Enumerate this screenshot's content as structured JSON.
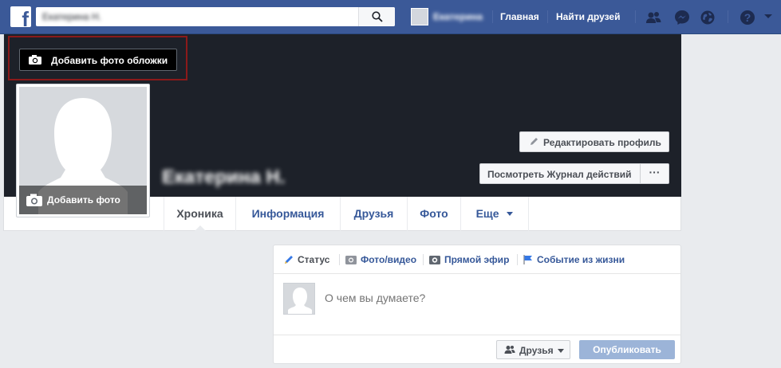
{
  "topbar": {
    "logo": "f",
    "search_value": "Екатерина Н.",
    "user_name": "Екатерина",
    "home_label": "Главная",
    "find_friends_label": "Найти друзей",
    "icons": [
      "friends-icon",
      "messenger-icon",
      "globe-icon",
      "help-icon",
      "chevron-down-icon"
    ]
  },
  "cover": {
    "add_cover_label": "Добавить фото обложки",
    "edit_profile_label": "Редактировать профиль",
    "activity_log_label": "Посмотреть Журнал действий",
    "more_label": "···",
    "profile_name": "Екатерина Н."
  },
  "profile_pic": {
    "add_photo_label": "Добавить фото"
  },
  "tabs": [
    {
      "label": "Хроника",
      "active": true
    },
    {
      "label": "Информация"
    },
    {
      "label": "Друзья"
    },
    {
      "label": "Фото"
    },
    {
      "label": "Еще"
    }
  ],
  "composer": {
    "tabs": {
      "status": "Статус",
      "photo_video": "Фото/видео",
      "live": "Прямой эфир",
      "life_event": "Событие из жизни"
    },
    "placeholder": "О чем вы думаете?",
    "audience_label": "Друзья",
    "publish_label": "Опубликовать"
  },
  "colors": {
    "brand": "#3b5998",
    "link": "#365899",
    "cover": "#1d2129",
    "publish_disabled": "#9cb4d8"
  }
}
